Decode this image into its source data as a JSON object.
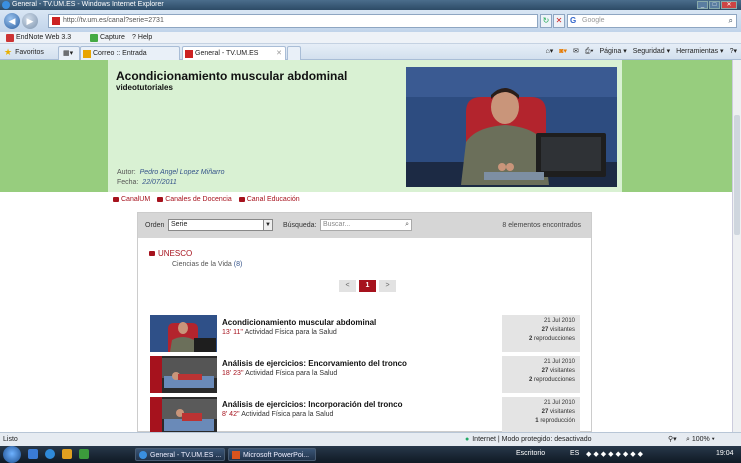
{
  "window": {
    "title": "General - TV.UM.ES - Windows Internet Explorer"
  },
  "addressbar": {
    "url": "http://tv.um.es/canal?serie=2731",
    "search_placeholder": "Google"
  },
  "linksbar": {
    "items": [
      "EndNote Web 3.3",
      "Capture",
      "Help"
    ]
  },
  "favbar": {
    "favorites_label": "Favoritos",
    "tabs": [
      {
        "label": "Correo :: Entrada"
      },
      {
        "label": "General - TV.UM.ES"
      }
    ],
    "commands": [
      "Página ▾",
      "Seguridad ▾",
      "Herramientas ▾",
      "?▾"
    ]
  },
  "header": {
    "title": "Acondicionamiento muscular abdominal",
    "subtitle": "videotutoriales",
    "author_label": "Autor:",
    "author": "Pedro Angel Lopez Miñarro",
    "date_label": "Fecha:",
    "date": "22/07/2011"
  },
  "channels": [
    "CanalUM",
    "Canales de Docencia",
    "Canal Educación"
  ],
  "filter": {
    "order_label": "Orden",
    "order_value": "Serie",
    "search_label": "Búsqueda:",
    "search_placeholder": "Buscar...",
    "count_text": "8 elementos encontrados"
  },
  "category": {
    "name": "UNESCO",
    "sub": "Ciencias de la Vida",
    "sub_count": "(8)"
  },
  "pager": {
    "prev": "<",
    "current": "1",
    "next": ">"
  },
  "videos": [
    {
      "title": "Acondicionamiento muscular abdominal",
      "duration": "13' 11''",
      "serie": "Actividad Física para la Salud",
      "date": "21 Jul 2010",
      "visitors": "27",
      "visitors_label": "visitantes",
      "plays": "2",
      "plays_label": "reproducciones"
    },
    {
      "title": "Análisis de ejercicios: Encorvamiento del tronco",
      "duration": "18' 23''",
      "serie": "Actividad Física para la Salud",
      "date": "21 Jul 2010",
      "visitors": "27",
      "visitors_label": "visitantes",
      "plays": "2",
      "plays_label": "reproducciones"
    },
    {
      "title": "Análisis de ejercicios: Incorporación del tronco",
      "duration": "8' 42''",
      "serie": "Actividad Física para la Salud",
      "date": "21 Jul 2010",
      "visitors": "27",
      "visitors_label": "visitantes",
      "plays": "1",
      "plays_label": "reproducción"
    }
  ],
  "statusbar": {
    "left": "Listo",
    "zone": "Internet | Modo protegido: desactivado",
    "zoom": "100%"
  },
  "taskbar": {
    "buttons": [
      "General - TV.UM.ES ...",
      "Microsoft PowerPoi..."
    ],
    "desktop_label": "Escritorio",
    "lang": "ES",
    "clock": "19:04"
  },
  "colors": {
    "accent": "#a6121d",
    "band": "#97cd7e",
    "header_bg": "#d9f1d3"
  }
}
